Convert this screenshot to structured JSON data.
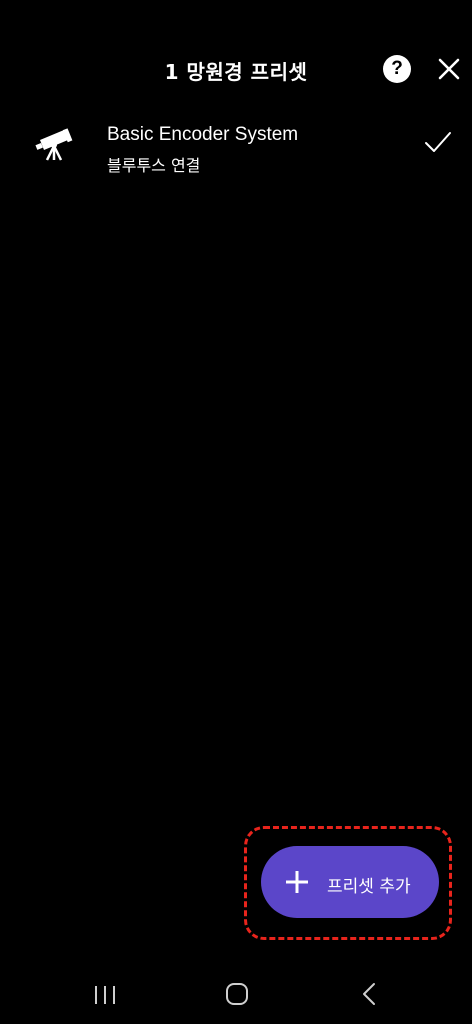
{
  "header": {
    "title": "1 망원경 프리셋",
    "help_label": "?",
    "help_icon": "help-icon",
    "close_icon": "close-icon"
  },
  "presets": [
    {
      "name": "Basic Encoder System",
      "subtitle": "블루투스 연결",
      "icon": "telescope-icon",
      "selected": true
    }
  ],
  "fab": {
    "label": "프리셋 추가",
    "icon": "plus-icon",
    "color": "#5b46c9",
    "highlight_color": "#e8241c"
  },
  "nav": {
    "recent_icon": "recent-apps-icon",
    "home_icon": "home-icon",
    "back_icon": "back-icon"
  }
}
